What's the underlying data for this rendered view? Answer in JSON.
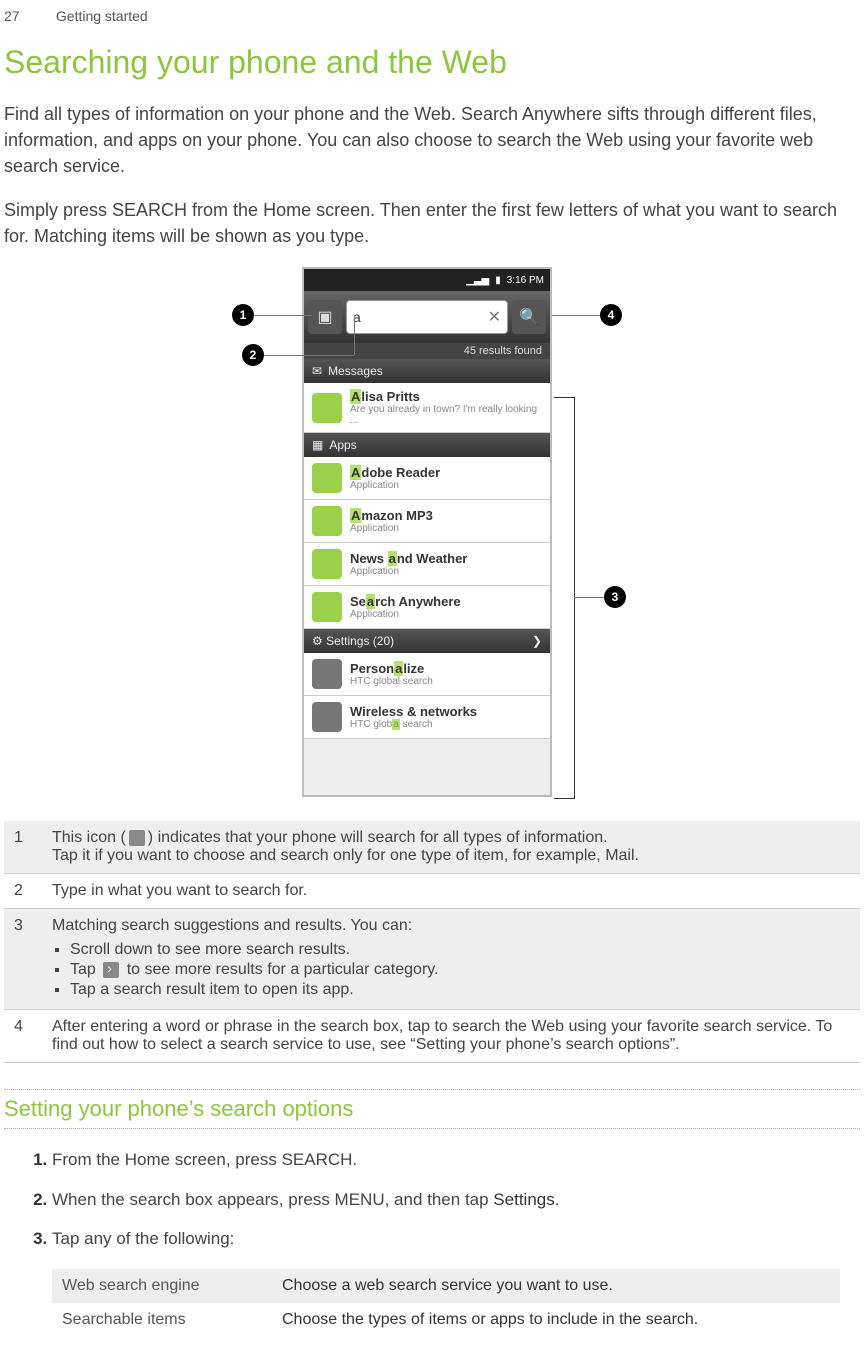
{
  "header": {
    "page_number": "27",
    "section": "Getting started"
  },
  "title": "Searching your phone and the Web",
  "intro1": "Find all types of information on your phone and the Web. Search Anywhere sifts through different files, information, and apps on your phone. You can also choose to search the Web using your favorite web search service.",
  "intro2": "Simply press SEARCH from the Home screen. Then enter the first few letters of what you want to search for. Matching items will be shown as you type.",
  "phone": {
    "status_time": "3:16 PM",
    "search_value": "a",
    "results_found": "45 results found",
    "sections": {
      "messages": "Messages",
      "apps": "Apps",
      "settings": "Settings (20)"
    },
    "msg_name_pre": "lisa Pritts",
    "msg_sub": "Are you already in town? I'm really looking ...",
    "apps_list": [
      {
        "pre": "A",
        "mid": "dobe Reader",
        "sub": "Application"
      },
      {
        "pre": "A",
        "mid": "mazon MP3",
        "sub": "Application"
      },
      {
        "pre": "News ",
        "mid": "nd Weather",
        "hl": "a",
        "sub": "Application"
      },
      {
        "pre": "Se",
        "mid": "rch Anywhere",
        "hl": "a",
        "sub": "Application"
      }
    ],
    "settings_list": [
      {
        "pre": "Person",
        "mid": "lize",
        "hl": "a",
        "sub": "HTC global search"
      },
      {
        "pre": "Wireless & networks",
        "sub": "HTC glob",
        "hl": "a",
        "tail": " search"
      }
    ]
  },
  "legend": {
    "1a": "This icon (",
    "1b": ") indicates that your phone will search for all types of information.",
    "1c": "Tap it if you want to choose and search only for one type of item, for example, Mail.",
    "2": "Type in what you want to search for.",
    "3": "Matching search suggestions and results. You can:",
    "3a": "Scroll down to see more search results.",
    "3b_pre": "Tap ",
    "3b_post": " to see more results for a particular category.",
    "3c": "Tap a search result item to open its app.",
    "4": "After entering a word or phrase in the search box, tap to search the Web using your favorite search service. To find out how to select a search service to use, see “Setting your phone’s search options”."
  },
  "subheading": "Setting your phone’s search options",
  "steps": {
    "1": "From the Home screen, press SEARCH.",
    "2_pre": "When the search box appears, press MENU, and then tap ",
    "2_link": "Settings",
    "2_post": ".",
    "3": "Tap any of the following:"
  },
  "options": [
    {
      "k": "Web search engine",
      "v": "Choose a web search service you want to use."
    },
    {
      "k": "Searchable items",
      "v": "Choose the types of items or apps to include in the search."
    }
  ]
}
